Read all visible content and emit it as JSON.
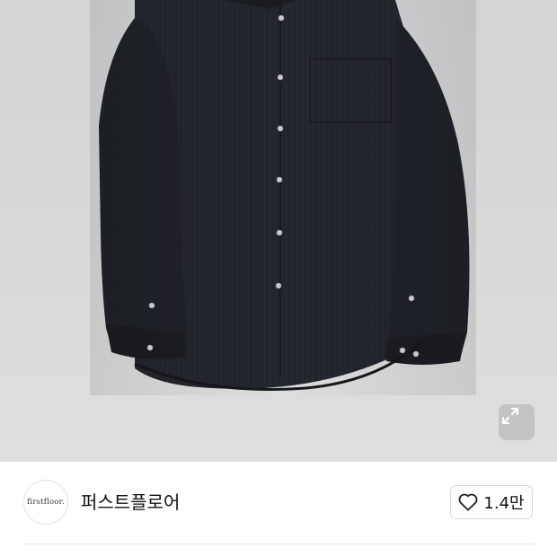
{
  "product_image": {
    "alt": "shirt-product-photo",
    "background_color": "#d7d7d9",
    "shirt_color": "#23262d"
  },
  "expand_icon": "expand-arrows-icon",
  "brand": {
    "logo_text": "firstfloor.",
    "name": "퍼스트플로어"
  },
  "like": {
    "icon": "heart-outline-icon",
    "count": "1.4만"
  }
}
